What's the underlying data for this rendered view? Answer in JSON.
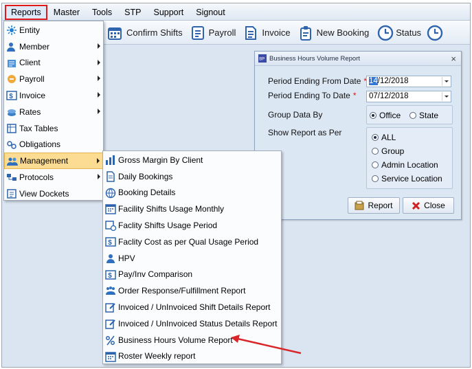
{
  "menubar": {
    "items": [
      {
        "label": "Reports",
        "active": true
      },
      {
        "label": "Master"
      },
      {
        "label": "Tools"
      },
      {
        "label": "STP"
      },
      {
        "label": "Support"
      },
      {
        "label": "Signout"
      }
    ]
  },
  "toolbar": {
    "buttons": [
      {
        "label": "Confirm Shifts",
        "icon": "calendar-icon"
      },
      {
        "label": "Payroll",
        "icon": "payroll-icon"
      },
      {
        "label": "Invoice",
        "icon": "invoice-icon"
      },
      {
        "label": "New Booking",
        "icon": "clipboard-icon"
      },
      {
        "label": "Status",
        "icon": "clock-icon"
      },
      {
        "label": "",
        "icon": "clock-icon"
      }
    ]
  },
  "reports_menu": {
    "items": [
      {
        "label": "Entity",
        "icon": "entity-icon",
        "submenu": false
      },
      {
        "label": "Member",
        "icon": "member-icon",
        "submenu": true
      },
      {
        "label": "Client",
        "icon": "client-icon",
        "submenu": true
      },
      {
        "label": "Payroll",
        "icon": "payroll-icon",
        "submenu": true
      },
      {
        "label": "Invoice",
        "icon": "invoice-dollar-icon",
        "submenu": true
      },
      {
        "label": "Rates",
        "icon": "rates-icon",
        "submenu": true
      },
      {
        "label": "Tax Tables",
        "icon": "tax-tables-icon",
        "submenu": false
      },
      {
        "label": "Obligations",
        "icon": "obligations-icon",
        "submenu": false
      },
      {
        "label": "Management",
        "icon": "management-icon",
        "submenu": true,
        "highlighted": true
      },
      {
        "label": "Protocols",
        "icon": "protocols-icon",
        "submenu": true
      },
      {
        "label": "View Dockets",
        "icon": "dockets-icon",
        "submenu": false
      }
    ]
  },
  "management_menu": {
    "items": [
      {
        "label": "Gross Margin By Client",
        "icon": "bar-chart-icon"
      },
      {
        "label": "Daily Bookings",
        "icon": "document-icon"
      },
      {
        "label": "Booking Details",
        "icon": "globe-icon"
      },
      {
        "label": "Facility Shifts Usage Monthly",
        "icon": "calendar-icon"
      },
      {
        "label": "Faclity Shifts Usage Period",
        "icon": "calendar-clock-icon"
      },
      {
        "label": "Faclity Cost as per Qual Usage Period",
        "icon": "dollar-doc-icon"
      },
      {
        "label": "HPV",
        "icon": "person-icon"
      },
      {
        "label": "Pay/Inv Comparison",
        "icon": "dollar-doc-icon"
      },
      {
        "label": "Order Response/Fulfillment Report",
        "icon": "people-icon"
      },
      {
        "label": "Invoiced / UnInvoiced Shift Details Report",
        "icon": "edit-doc-icon"
      },
      {
        "label": "Invoiced / UnInvoiced Status Details Report",
        "icon": "edit-doc-icon"
      },
      {
        "label": "Business Hours Volume Report",
        "icon": "percent-icon"
      },
      {
        "label": "Roster Weekly report",
        "icon": "calendar-icon"
      }
    ]
  },
  "dialog": {
    "title": "Business Hours Volume Report",
    "from_label": "Period Ending From Date",
    "from_value_selected": "14",
    "from_value_rest": "/12/2018",
    "to_label": "Period Ending To Date",
    "to_value": "07/12/2018",
    "required_mark": "*",
    "group_label": "Group Data By",
    "group_options": [
      {
        "label": "Office",
        "checked": true
      },
      {
        "label": "State",
        "checked": false
      }
    ],
    "show_label": "Show Report as Per",
    "show_options": [
      {
        "label": "ALL",
        "checked": true
      },
      {
        "label": "Group",
        "checked": false
      },
      {
        "label": "Admin Location",
        "checked": false
      },
      {
        "label": "Service Location",
        "checked": false
      }
    ],
    "report_button": "Report",
    "close_button": "Close",
    "close_glyph": "×"
  },
  "colors": {
    "highlight": "#fbdc92",
    "annotation_arrow": "#d9262a",
    "menu_outline": "#e11919"
  }
}
